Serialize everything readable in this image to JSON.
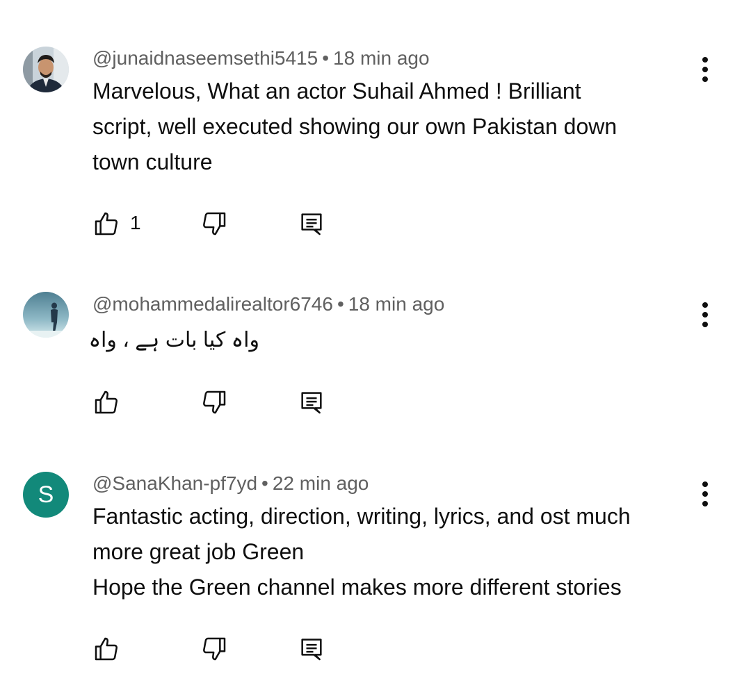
{
  "comments": [
    {
      "author": "@junaidnaseemsethi5415",
      "separator": "•",
      "time": "18 min ago",
      "text_lines": [
        "Marvelous, What an actor Suhail Ahmed ! Brilliant",
        "script, well executed showing our own Pakistan down",
        "town culture"
      ],
      "likes": "1",
      "avatar_type": "photo-person"
    },
    {
      "author": "@mohammedalirealtor6746",
      "separator": "•",
      "time": "18 min ago",
      "text_lines": [
        "واہ کیا بات ہے ، واہ"
      ],
      "likes": "",
      "avatar_type": "photo-runner"
    },
    {
      "author": "@SanaKhan-pf7yd",
      "separator": "•",
      "time": "22 min ago",
      "text_lines": [
        "Fantastic acting, direction, writing, lyrics, and ost much",
        "more great job Green",
        "Hope the Green channel makes more different stories"
      ],
      "likes": "",
      "avatar_letter": "S",
      "avatar_color": "#12897a"
    }
  ],
  "icons": {
    "like": "thumbs-up-icon",
    "dislike": "thumbs-down-icon",
    "reply": "reply-icon",
    "more": "more-vert-icon"
  }
}
